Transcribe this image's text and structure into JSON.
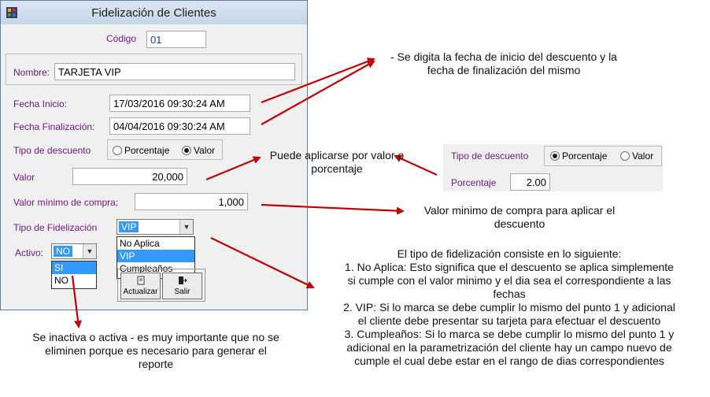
{
  "window": {
    "title": "Fidelización de Clientes"
  },
  "form": {
    "codigo_label": "Código",
    "codigo_value": "01",
    "nombre_label": "Nombre:",
    "nombre_value": "TARJETA VIP",
    "fecha_inicio_label": "Fecha Inicio:",
    "fecha_inicio_value": "17/03/2016 09:30:24 AM",
    "fecha_fin_label": "Fecha Finalización:",
    "fecha_fin_value": "04/04/2016 09:30:24 AM",
    "tipo_descuento_label": "Tipo de descuento",
    "opt_porcentaje": "Porcentaje",
    "opt_valor": "Valor",
    "valor_label": "Valor",
    "valor_value": "20,000",
    "valor_minimo_label": "Valor mínimo de compra:",
    "valor_minimo_value": "1,000",
    "tipo_fidelizacion_label": "Tipo de Fidelización",
    "tipo_fidelizacion_selected": "VIP",
    "tipo_fidelizacion_options": [
      "No Aplica",
      "VIP",
      "Cumpleaños"
    ],
    "activo_label": "Activo:",
    "activo_selected": "NO",
    "activo_options": [
      "SI",
      "NO"
    ],
    "btn_actualizar": "Actualizar",
    "btn_salir": "Salir"
  },
  "inset": {
    "tipo_descuento_label": "Tipo de descuento",
    "opt_porcentaje": "Porcentaje",
    "opt_valor": "Valor",
    "porcentaje_label": "Porcentaje",
    "porcentaje_value": "2.00"
  },
  "notes": {
    "fechas_1": "- Se digita la fecha de inicio del descuento y la",
    "fechas_2": "fecha de finalización del mismo",
    "tipo_1": "Puede aplicarse por valor o",
    "tipo_2": "porcentaje",
    "minimo_1": "Valor minimo de compra para aplicar el",
    "minimo_2": "descuento",
    "fid_title": "El tipo de fidelización consiste en lo siguiente:",
    "fid_1a": "1. No Aplica: Esto significa que el descuento se aplica simplemente",
    "fid_1b": "si cumple con el valor minimo y el dia sea el correspondiente a las",
    "fid_1c": "fechas",
    "fid_2a": "2. VIP: Si lo marca se debe cumplir lo mismo del punto 1 y adicional",
    "fid_2b": "el cliente debe presentar su tarjeta para efectuar el descuento",
    "fid_3a": "3. Cumpleaños: Si lo marca se debe cumplir lo mismo del punto 1 y",
    "fid_3b": "adicional en la parametrización del cliente hay un campo nuevo de",
    "fid_3c": "cumple el cual debe estar en el rango de dias correspondientes",
    "activo_1": "Se inactiva o activa - es muy importante que no se",
    "activo_2": "eliminen porque es necesario para generar el",
    "activo_3": "reporte"
  },
  "colors": {
    "label": "#6b1a7c",
    "arrow": "#c00000",
    "selection": "#3399ff"
  }
}
